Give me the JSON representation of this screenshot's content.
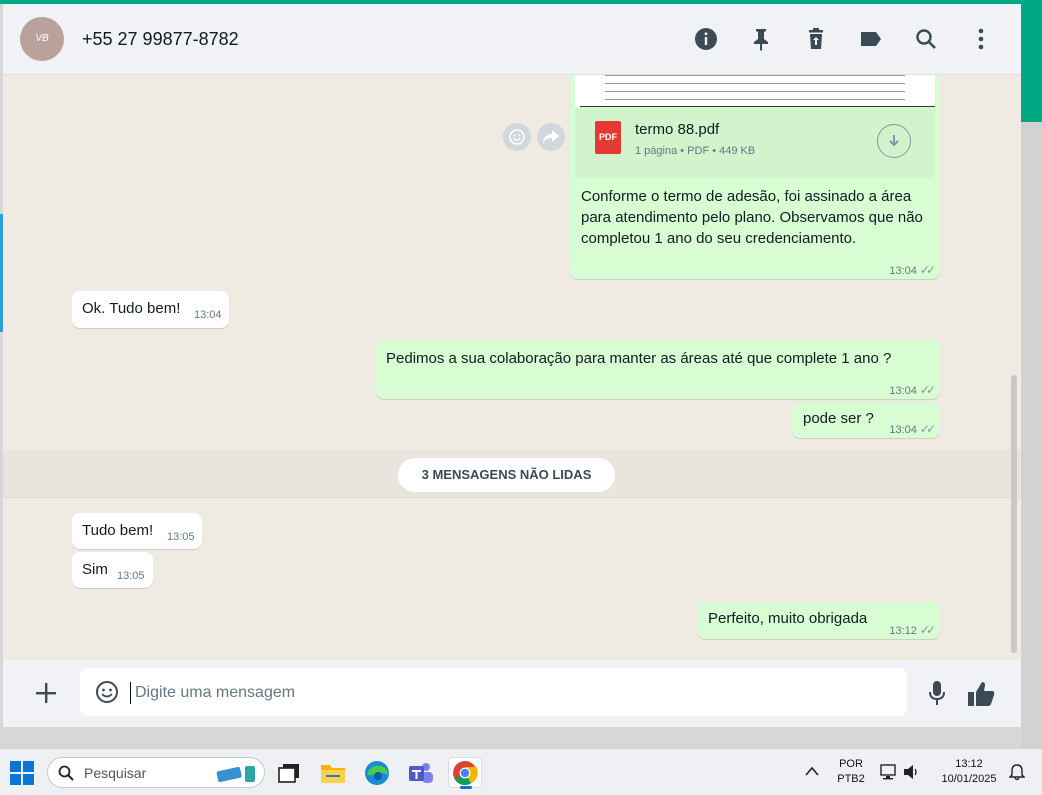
{
  "header": {
    "contact_name": "+55 27 99877-8782",
    "avatar_initials": "VB"
  },
  "chat": {
    "attachment": {
      "file_name": "termo 88.pdf",
      "file_meta": "1 página • PDF • 449 KB",
      "file_type": "PDF"
    },
    "messages": [
      {
        "direction": "out",
        "text": "Conforme o termo de adesão, foi assinado a área para atendimento pelo plano. Observamos que não completou 1 ano do seu credenciamento.",
        "time": "13:04"
      },
      {
        "direction": "in",
        "text": "Ok. Tudo bem!",
        "time": "13:04"
      },
      {
        "direction": "out",
        "text": "Pedimos a sua colaboração para manter as áreas até que complete 1 ano ?",
        "time": "13:04"
      },
      {
        "direction": "out",
        "text": "pode ser ?",
        "time": "13:04"
      },
      {
        "direction": "in",
        "text": "Tudo bem!",
        "time": "13:05"
      },
      {
        "direction": "in",
        "text": "Sim",
        "time": "13:05"
      },
      {
        "direction": "out",
        "text": "Perfeito, muito obrigada",
        "time": "13:12"
      }
    ],
    "unread_divider": "3 MENSAGENS NÃO LIDAS"
  },
  "footer": {
    "placeholder": "Digite uma mensagem"
  },
  "taskbar": {
    "search_label": "Pesquisar",
    "lang_line1": "POR",
    "lang_line2": "PTB2",
    "clock_time": "13:12",
    "clock_date": "10/01/2025"
  },
  "colors": {
    "outgoing": "#d9fdd3",
    "incoming": "#ffffff",
    "accent": "#00a884",
    "pdf_red": "#e53935"
  }
}
